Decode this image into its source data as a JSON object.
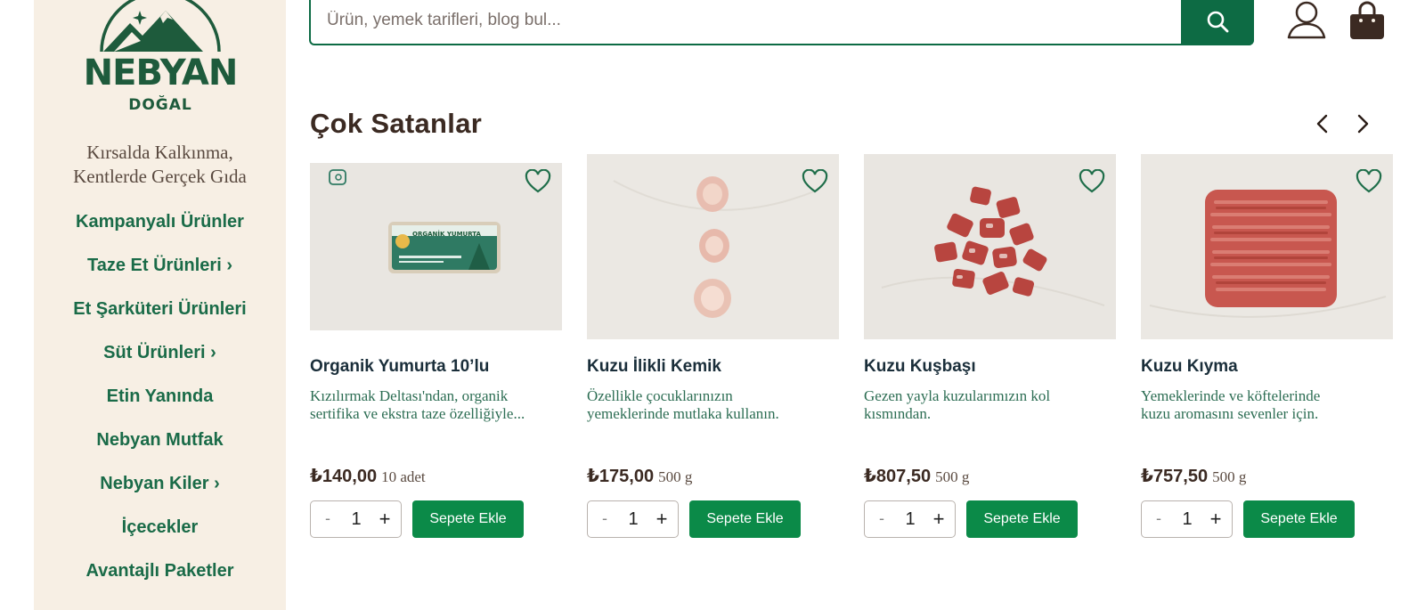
{
  "brand": {
    "name": "NEBYAN",
    "sub": "DOĞAL",
    "tagline_line1": "Kırsalda Kalkınma,",
    "tagline_line2": "Kentlerde Gerçek Gıda",
    "color": "#1e5b3c"
  },
  "sidebar": {
    "items": [
      {
        "label": "Kampanyalı Ürünler"
      },
      {
        "label": "Taze Et Ürünleri ›"
      },
      {
        "label": "Et Şarküteri Ürünleri"
      },
      {
        "label": "Süt Ürünleri ›"
      },
      {
        "label": "Etin Yanında"
      },
      {
        "label": "Nebyan Mutfak"
      },
      {
        "label": "Nebyan Kiler ›"
      },
      {
        "label": "İçecekler"
      },
      {
        "label": "Avantajlı Paketler"
      }
    ]
  },
  "header": {
    "search_placeholder": "Ürün, yemek tarifleri, blog bul...",
    "icons": [
      "search-icon",
      "user-icon",
      "shopping-bag-icon"
    ]
  },
  "section": {
    "title": "Çok Satanlar"
  },
  "products": [
    {
      "name": "Organik Yumurta 10’lu",
      "desc1": "Kızılırmak Deltası'ndan, organik",
      "desc2": "sertifika ve ekstra taze özelliğiyle...",
      "price": "₺140,00",
      "unit": "10 adet",
      "qty": "1",
      "add_label": "Sepete Ekle",
      "minus": "-",
      "plus": "+"
    },
    {
      "name": "Kuzu İlikli Kemik",
      "desc1": "Özellikle çocuklarınızın",
      "desc2": "yemeklerinde mutlaka kullanın.",
      "price": "₺175,00",
      "unit": "500 g",
      "qty": "1",
      "add_label": "Sepete Ekle",
      "minus": "-",
      "plus": "+"
    },
    {
      "name": "Kuzu Kuşbaşı",
      "desc1": "Gezen yayla kuzularımızın kol",
      "desc2": "kısmından.",
      "price": "₺807,50",
      "unit": "500 g",
      "qty": "1",
      "add_label": "Sepete Ekle",
      "minus": "-",
      "plus": "+"
    },
    {
      "name": "Kuzu Kıyma",
      "desc1": "Yemeklerinde ve köftelerinde",
      "desc2": "kuzu aromasını sevenler için.",
      "price": "₺757,50",
      "unit": "500 g",
      "qty": "1",
      "add_label": "Sepete Ekle",
      "minus": "-",
      "plus": "+"
    }
  ],
  "colors": {
    "primary_green": "#0d6b44",
    "button_green": "#0b8a48",
    "sidebar_bg": "#f7efe4",
    "menu_text": "#1a6b48"
  }
}
